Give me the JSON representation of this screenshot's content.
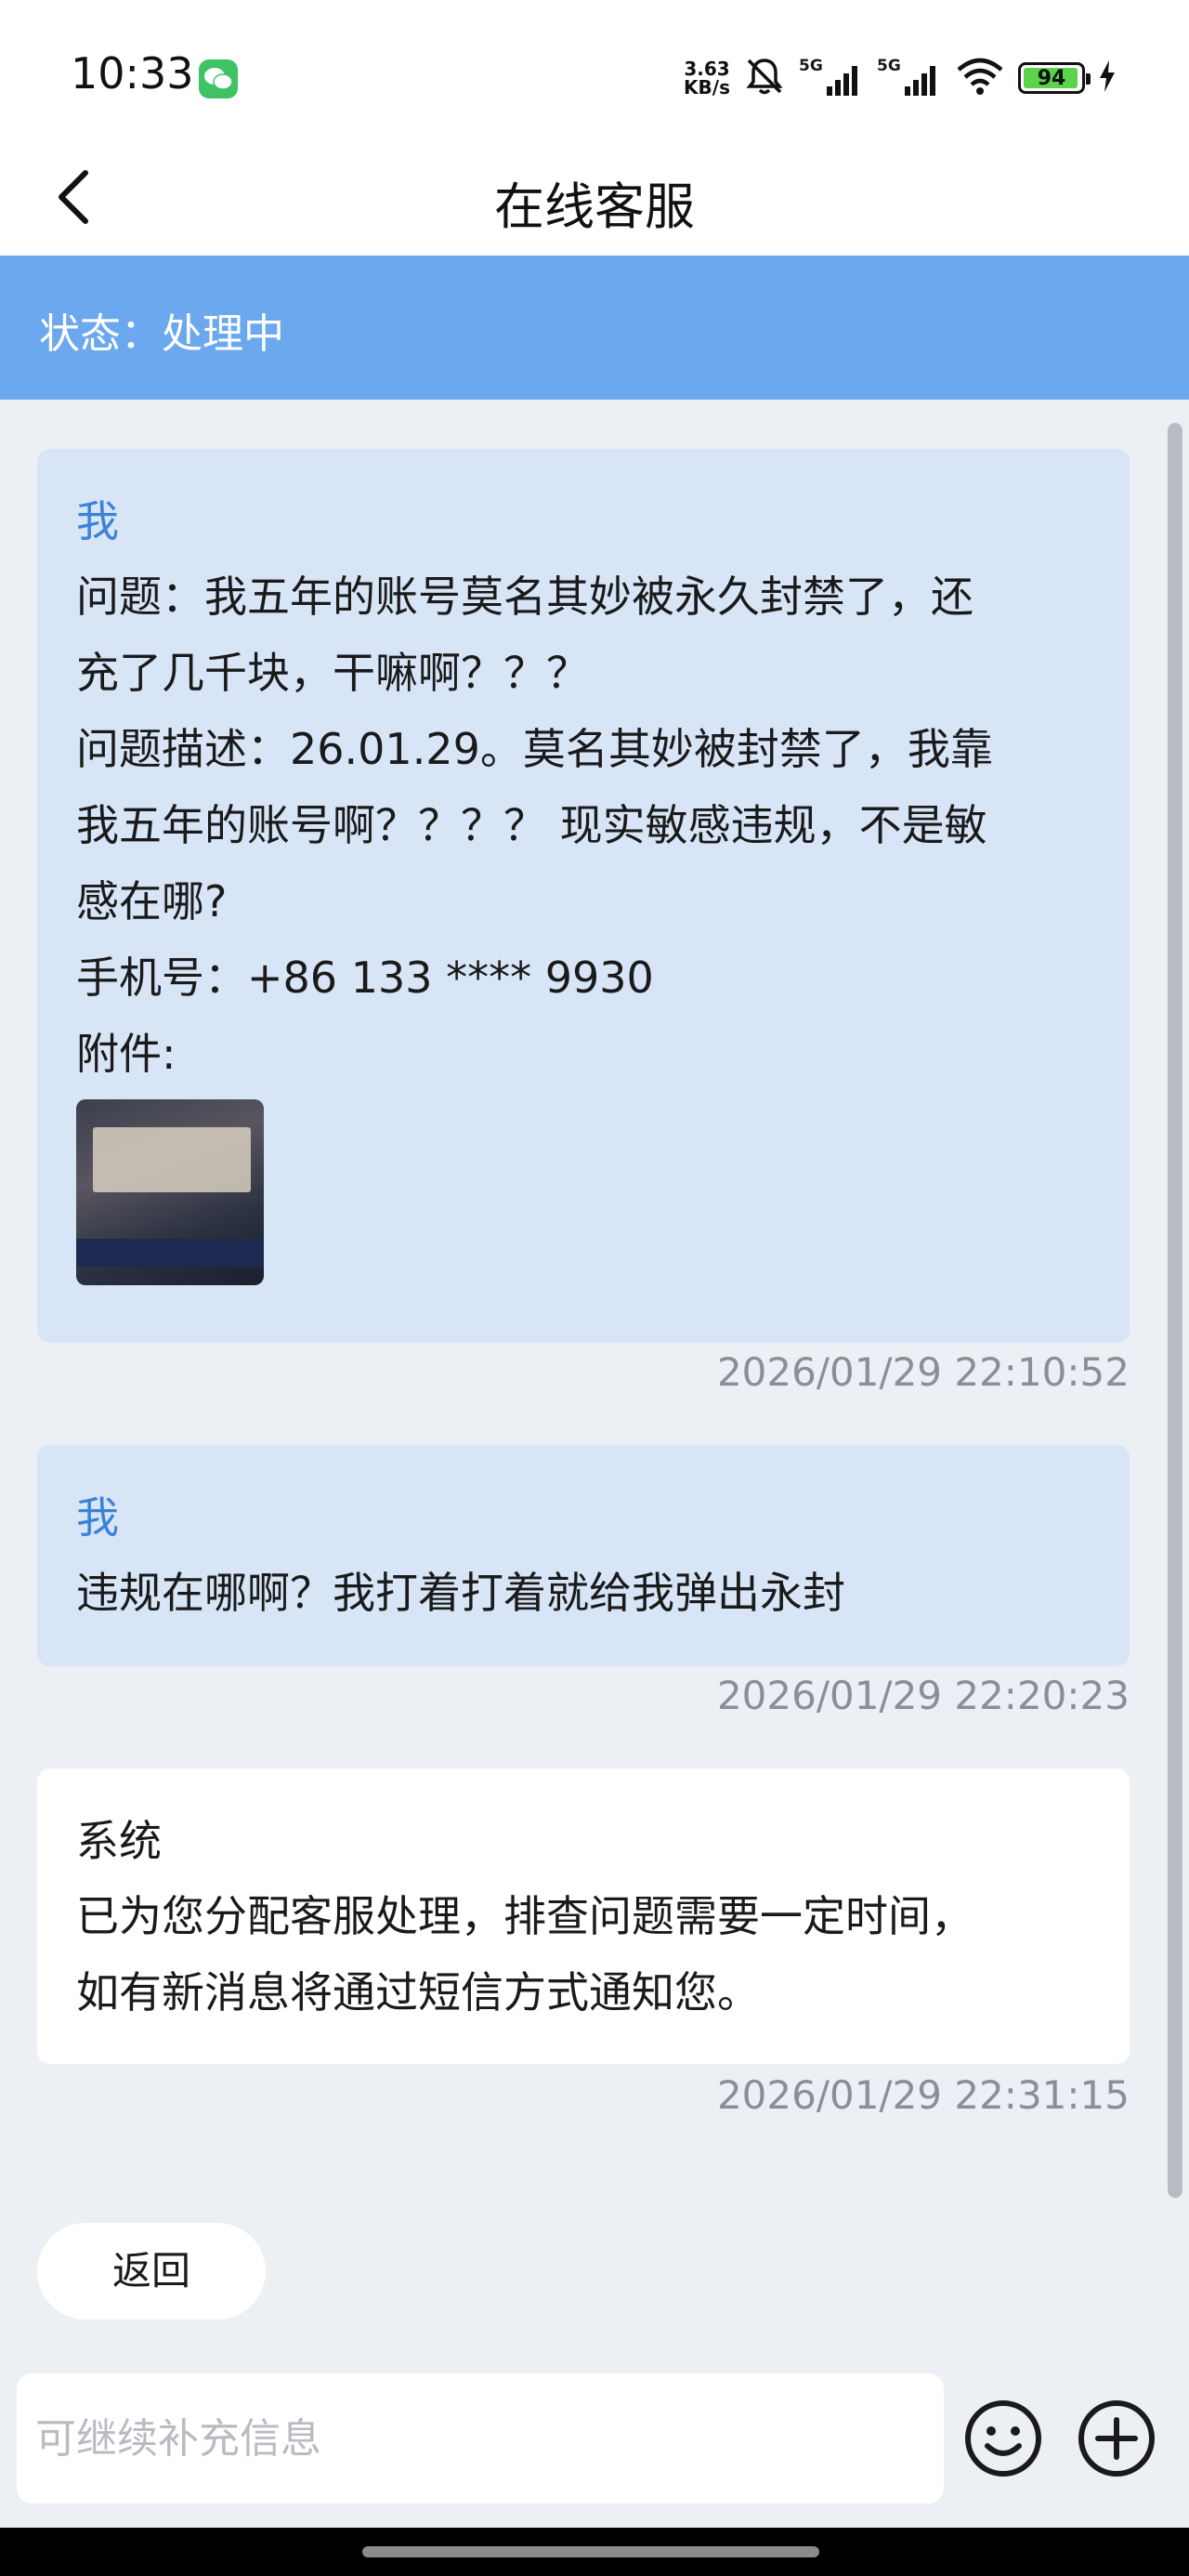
{
  "status_bar": {
    "time": "10:33",
    "net_speed_value": "3.63",
    "net_speed_unit": "KB/s",
    "signal_1_label": "5G",
    "signal_2_label": "5G",
    "battery_level": "94"
  },
  "nav": {
    "title": "在线客服"
  },
  "ticket": {
    "status": "状态：处理中"
  },
  "messages": [
    {
      "sender": "我",
      "lines": [
        "问题：我五年的账号莫名其妙被永久封禁了，还",
        "充了几千块，干嘛啊？？？",
        "问题描述：26.01.29。莫名其妙被封禁了，我靠",
        "我五年的账号啊？？？？ 现实敏感违规，不是敏",
        "感在哪?",
        "手机号：+86 133 **** 9930",
        "附件:"
      ],
      "timestamp": "2026/01/29 22:10:52"
    },
    {
      "sender": "我",
      "lines": [
        "违规在哪啊？我打着打着就给我弹出永封"
      ],
      "timestamp": "2026/01/29 22:20:23"
    },
    {
      "sender": "系统",
      "lines": [
        "已为您分配客服处理，排查问题需要一定时间，",
        "如有新消息将通过短信方式通知您。"
      ],
      "timestamp": "2026/01/29 22:31:15"
    }
  ],
  "actions": {
    "return_label": "返回"
  },
  "input": {
    "placeholder": "可继续补充信息",
    "value": ""
  },
  "icons": {
    "back": "chevron-left-icon",
    "emoji": "smiley-icon",
    "plus": "plus-circle-icon"
  },
  "colors": {
    "status_banner": "#6CA8EE",
    "user_bubble": "#D7E5F6",
    "user_sender": "#3A83D8",
    "system_bubble": "#FFFFFF",
    "page_background": "#ECEFF3"
  }
}
